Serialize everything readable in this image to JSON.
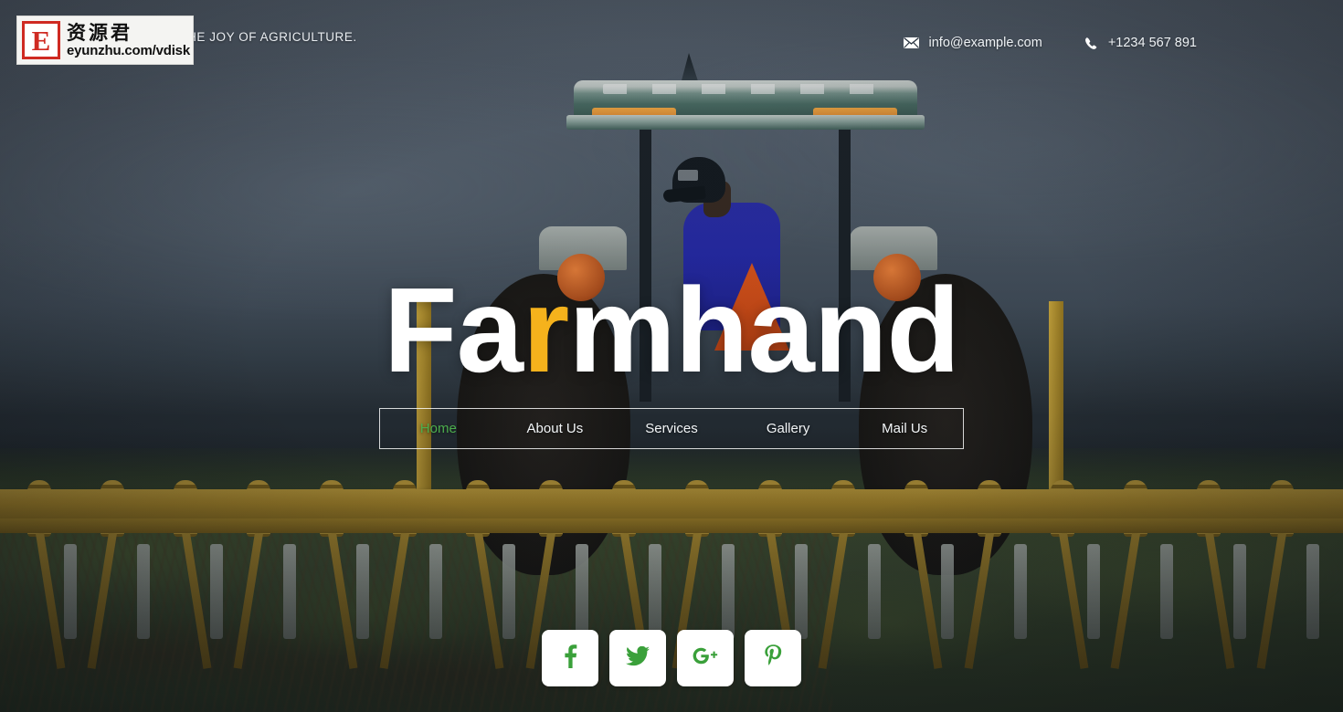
{
  "header": {
    "tagline": "CELEBRATE THE JOY OF AGRICULTURE.",
    "contacts": [
      {
        "icon": "envelope-icon",
        "value": "info@example.com"
      },
      {
        "icon": "phone-icon",
        "value": "+1234 567 891"
      }
    ]
  },
  "brand": {
    "prefix": "Fa",
    "accent": "r",
    "suffix": "mhand",
    "full": "Farmhand",
    "accent_color": "#f5b21c",
    "base_color": "#ffffff"
  },
  "nav": {
    "items": [
      {
        "label": "Home",
        "active": true
      },
      {
        "label": "About Us",
        "active": false
      },
      {
        "label": "Services",
        "active": false
      },
      {
        "label": "Gallery",
        "active": false
      },
      {
        "label": "Mail Us",
        "active": false
      }
    ],
    "active_color": "#4cae4c",
    "inactive_color": "#f2f5f7"
  },
  "social": {
    "icon_color": "#3aa03a",
    "tile_color": "#ffffff",
    "items": [
      {
        "name": "facebook-icon",
        "label": "f"
      },
      {
        "name": "twitter-icon",
        "label": "t"
      },
      {
        "name": "google-plus-icon",
        "label": "g+"
      },
      {
        "name": "pinterest-icon",
        "label": "p"
      }
    ]
  },
  "watermark": {
    "badge": "E",
    "chinese": "资源君",
    "url": "eyunzhu.com/vdisk",
    "badge_color": "#cf2a22"
  }
}
